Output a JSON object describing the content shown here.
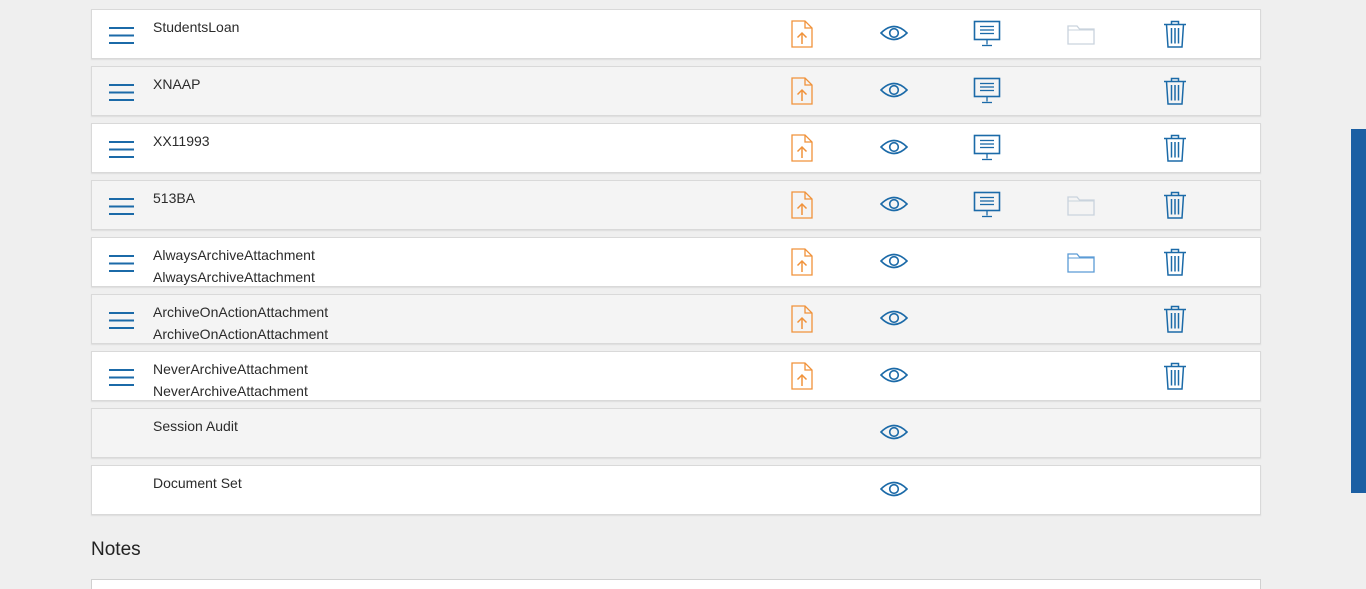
{
  "documents": [
    {
      "lines": [
        "StudentsLoan"
      ],
      "drag": true,
      "upload": true,
      "view": true,
      "present": true,
      "folder": "faded",
      "delete": true
    },
    {
      "lines": [
        "XNAAP"
      ],
      "drag": true,
      "upload": true,
      "view": true,
      "present": true,
      "folder": "none",
      "delete": true
    },
    {
      "lines": [
        "XX11993"
      ],
      "drag": true,
      "upload": true,
      "view": true,
      "present": true,
      "folder": "none",
      "delete": true
    },
    {
      "lines": [
        "513BA"
      ],
      "drag": true,
      "upload": true,
      "view": true,
      "present": true,
      "folder": "faded",
      "delete": true
    },
    {
      "lines": [
        "AlwaysArchiveAttachment",
        "AlwaysArchiveAttachment"
      ],
      "drag": true,
      "upload": true,
      "view": true,
      "present": false,
      "folder": "active",
      "delete": true
    },
    {
      "lines": [
        "ArchiveOnActionAttachment",
        "ArchiveOnActionAttachment"
      ],
      "drag": true,
      "upload": true,
      "view": true,
      "present": false,
      "folder": "none",
      "delete": true
    },
    {
      "lines": [
        "NeverArchiveAttachment",
        "NeverArchiveAttachment"
      ],
      "drag": true,
      "upload": true,
      "view": true,
      "present": false,
      "folder": "none",
      "delete": true
    },
    {
      "lines": [
        "Session Audit"
      ],
      "drag": false,
      "upload": false,
      "view": true,
      "present": false,
      "folder": "none",
      "delete": false
    },
    {
      "lines": [
        "Document Set"
      ],
      "drag": false,
      "upload": false,
      "view": true,
      "present": false,
      "folder": "none",
      "delete": false
    }
  ],
  "notes": {
    "title": "Notes"
  },
  "icons": {
    "drag": "hamburger-icon",
    "upload": "file-upload-icon",
    "view": "eye-icon",
    "present": "presentation-icon",
    "folder": "folder-icon",
    "delete": "trash-icon"
  },
  "colors": {
    "accent_blue": "#1b6aa8",
    "upload_orange": "#f0923a",
    "folder_faded": "#c9d3dd",
    "folder_active": "#5b9bd5",
    "scrollbar": "#1b5fa3"
  }
}
